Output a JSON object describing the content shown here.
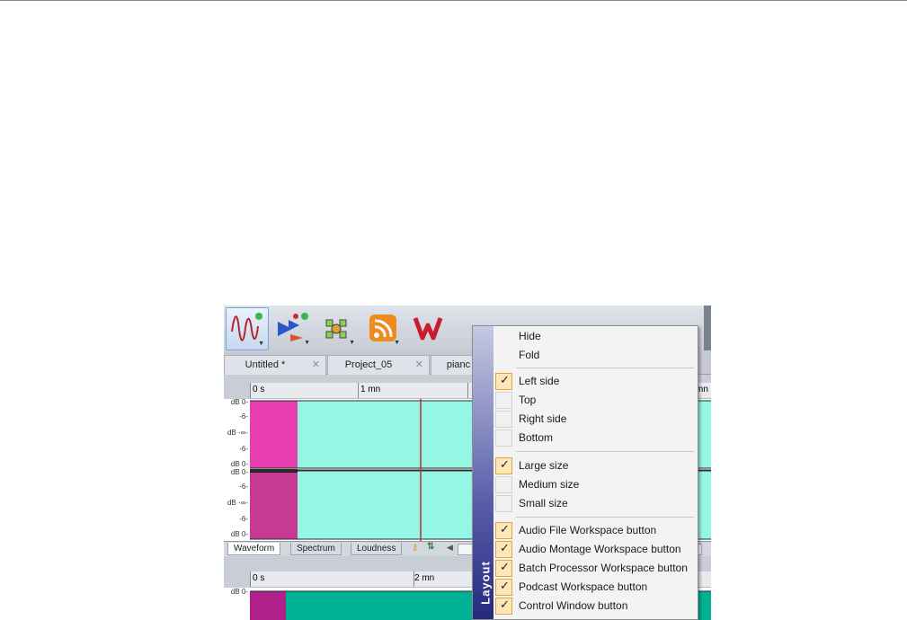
{
  "toolbar": {
    "tools": [
      {
        "icon": "audio-file-workspace-icon",
        "active": true
      },
      {
        "icon": "audio-montage-workspace-icon"
      },
      {
        "icon": "batch-processor-workspace-icon"
      },
      {
        "icon": "podcast-workspace-icon"
      },
      {
        "icon": "control-window-icon"
      }
    ]
  },
  "tabs": [
    {
      "label": "Untitled *",
      "close": "✕"
    },
    {
      "label": "Project_05",
      "close": "✕"
    },
    {
      "label": "pianc",
      "close": ""
    }
  ],
  "ruler_top": {
    "start": "0 s",
    "mid": "1 mn",
    "end": "mn"
  },
  "ruler_bottom": {
    "start": "0 s",
    "mid": "2 mn"
  },
  "db_labels": {
    "ch1": [
      "dB 0-",
      "-6-",
      "dB -∞-",
      "-6-",
      "dB 0-"
    ],
    "ch2": [
      "dB 0-",
      "-6-",
      "dB -∞-",
      "-6-",
      "dB 0-"
    ],
    "ch3": [
      "dB 0-"
    ]
  },
  "bottom_tabs": [
    "Waveform",
    "Spectrum",
    "Loudness"
  ],
  "colors": {
    "selection": "#e83fb0",
    "waveform": "#96f6e6",
    "waveform_dark": "#00b294",
    "menu_strip_top": "#c6c9e2",
    "menu_strip_bottom": "#252a7e",
    "check_bg": "#fde6b9"
  },
  "context_menu": {
    "title": "Layout",
    "items": [
      {
        "label": "Hide",
        "checked": false,
        "checkbox": false
      },
      {
        "label": "Fold",
        "checked": false,
        "checkbox": false
      },
      {
        "label": "Left side",
        "checked": true,
        "checkbox": true
      },
      {
        "label": "Top",
        "checked": false,
        "checkbox": true
      },
      {
        "label": "Right side",
        "checked": false,
        "checkbox": true
      },
      {
        "label": "Bottom",
        "checked": false,
        "checkbox": true
      },
      {
        "label": "Large size",
        "checked": true,
        "checkbox": true
      },
      {
        "label": "Medium size",
        "checked": false,
        "checkbox": true
      },
      {
        "label": "Small size",
        "checked": false,
        "checkbox": true
      },
      {
        "label": "Audio File Workspace button",
        "checked": true,
        "checkbox": true
      },
      {
        "label": "Audio Montage Workspace button",
        "checked": true,
        "checkbox": true
      },
      {
        "label": "Batch Processor Workspace button",
        "checked": true,
        "checkbox": true
      },
      {
        "label": "Podcast Workspace button",
        "checked": true,
        "checkbox": true
      },
      {
        "label": "Control Window button",
        "checked": true,
        "checkbox": true
      }
    ]
  }
}
